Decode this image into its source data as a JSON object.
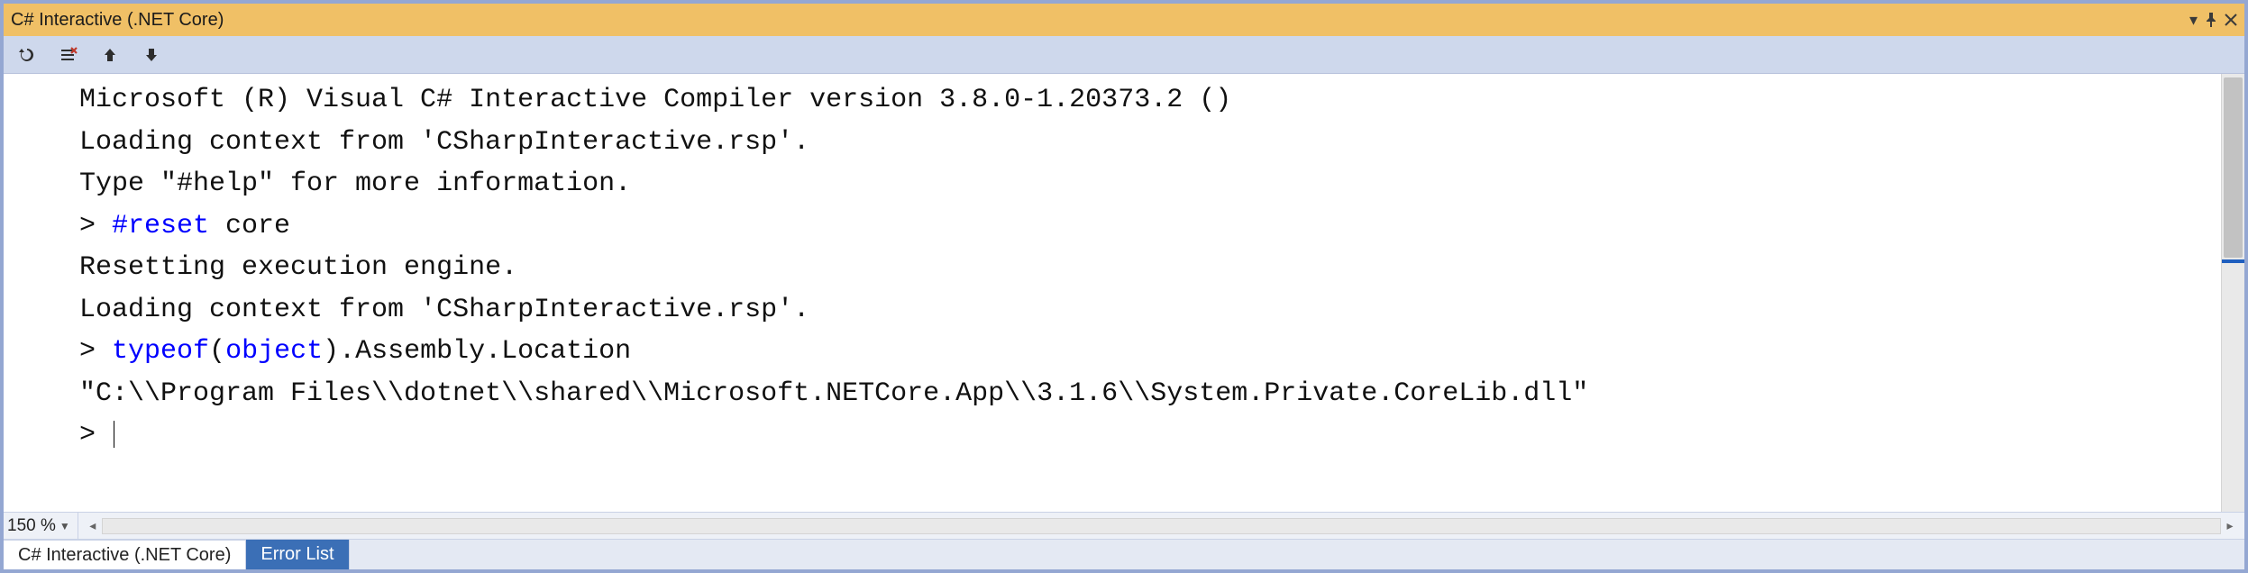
{
  "title": "C# Interactive (.NET Core)",
  "toolbar": {
    "reset_tooltip": "Reset",
    "clear_tooltip": "Clear",
    "history_up_tooltip": "History Previous",
    "history_down_tooltip": "History Next"
  },
  "console": {
    "lines": [
      {
        "type": "text",
        "text": "Microsoft (R) Visual C# Interactive Compiler version 3.8.0-1.20373.2 ()"
      },
      {
        "type": "text",
        "text": "Loading context from 'CSharpInteractive.rsp'."
      },
      {
        "type": "text",
        "text": "Type \"#help\" for more information."
      },
      {
        "type": "prompt",
        "segments": [
          {
            "t": "> "
          },
          {
            "t": "#reset",
            "c": "kw"
          },
          {
            "t": " core"
          }
        ]
      },
      {
        "type": "text",
        "text": "Resetting execution engine."
      },
      {
        "type": "text",
        "text": "Loading context from 'CSharpInteractive.rsp'."
      },
      {
        "type": "prompt",
        "segments": [
          {
            "t": "> "
          },
          {
            "t": "typeof",
            "c": "kw"
          },
          {
            "t": "("
          },
          {
            "t": "object",
            "c": "kw"
          },
          {
            "t": ").Assembly.Location"
          }
        ]
      },
      {
        "type": "text",
        "text": "\"C:\\\\Program Files\\\\dotnet\\\\shared\\\\Microsoft.NETCore.App\\\\3.1.6\\\\System.Private.CoreLib.dll\""
      },
      {
        "type": "caret",
        "text": "> "
      }
    ]
  },
  "status": {
    "zoom": "150 %"
  },
  "tabs": {
    "active": "C# Interactive (.NET Core)",
    "inactive": "Error List"
  }
}
